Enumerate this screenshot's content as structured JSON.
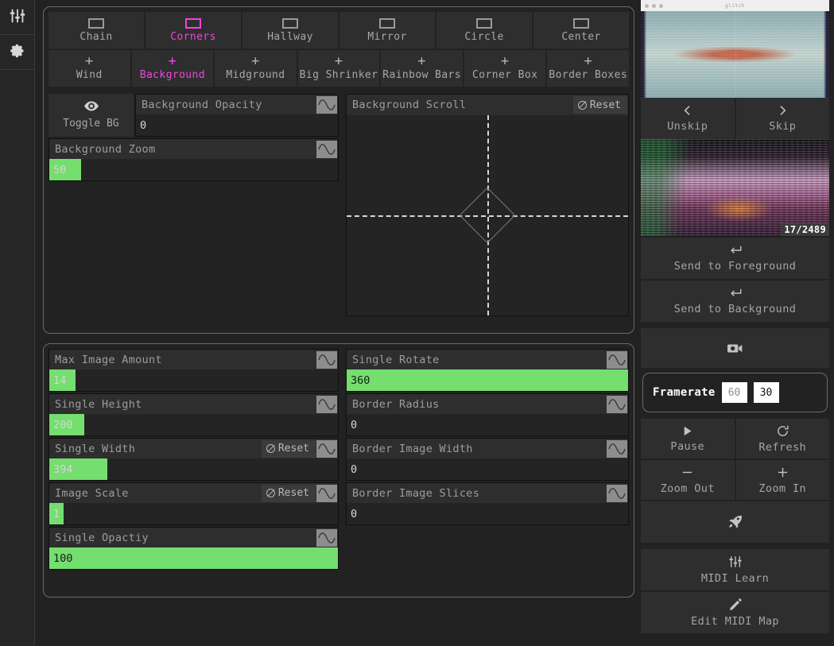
{
  "left_rail": {
    "items": [
      {
        "icon": "sliders-icon",
        "name": "mixer"
      },
      {
        "icon": "gear-icon",
        "name": "settings"
      }
    ]
  },
  "effects_panel": {
    "tabs_row1": [
      {
        "label": "Chain",
        "icon": "rect-icon",
        "active": false
      },
      {
        "label": "Corners",
        "icon": "rect-icon",
        "active": true
      },
      {
        "label": "Hallway",
        "icon": "rect-icon",
        "active": false
      },
      {
        "label": "Mirror",
        "icon": "rect-icon",
        "active": false
      },
      {
        "label": "Circle",
        "icon": "rect-icon",
        "active": false
      },
      {
        "label": "Center",
        "icon": "rect-icon",
        "active": false
      }
    ],
    "tabs_row2": [
      {
        "label": "Wind",
        "icon": "plus-icon",
        "active": false
      },
      {
        "label": "Background",
        "icon": "plus-icon",
        "active": true
      },
      {
        "label": "Midground",
        "icon": "plus-icon",
        "active": false
      },
      {
        "label": "Big Shrinker",
        "icon": "plus-icon",
        "active": false
      },
      {
        "label": "Rainbow Bars",
        "icon": "plus-icon",
        "active": false
      },
      {
        "label": "Corner Box",
        "icon": "plus-icon",
        "active": false
      },
      {
        "label": "Border Boxes",
        "icon": "plus-icon",
        "active": false
      }
    ],
    "toggle_bg": {
      "label": "Toggle BG",
      "icon": "eye-icon"
    },
    "sliders": [
      {
        "label": "Background Opacity",
        "value": "0",
        "fill_pct": 0,
        "has_reset": false,
        "wave": true
      },
      {
        "label": "Background Zoom",
        "value": "50",
        "fill_pct": 11,
        "has_reset": false,
        "wave": true
      }
    ],
    "xy_pad": {
      "label": "Background Scroll",
      "reset_label": "Reset"
    }
  },
  "params_panel": {
    "left_sliders": [
      {
        "label": "Max Image Amount",
        "value": "14",
        "fill_pct": 9,
        "has_reset": false,
        "wave": true
      },
      {
        "label": "Single Height",
        "value": "200",
        "fill_pct": 12,
        "has_reset": false,
        "wave": true
      },
      {
        "label": "Single Width",
        "value": "394",
        "fill_pct": 20,
        "has_reset": true,
        "wave": true
      },
      {
        "label": "Image Scale",
        "value": "1",
        "fill_pct": 5,
        "has_reset": true,
        "wave": true
      },
      {
        "label": "Single Opactiy",
        "value": "100",
        "fill_pct": 100,
        "has_reset": false,
        "wave": true
      }
    ],
    "right_sliders": [
      {
        "label": "Single Rotate",
        "value": "360",
        "fill_pct": 100,
        "has_reset": false,
        "wave": true
      },
      {
        "label": "Border Radius",
        "value": "0",
        "fill_pct": 0,
        "has_reset": false,
        "wave": true
      },
      {
        "label": "Border Image Width",
        "value": "0",
        "fill_pct": 0,
        "has_reset": false,
        "wave": true
      },
      {
        "label": "Border Image Slices",
        "value": "0",
        "fill_pct": 0,
        "has_reset": false,
        "wave": true
      }
    ],
    "reset_label": "Reset"
  },
  "sidebar": {
    "mini_window": {
      "title": "glitch"
    },
    "skip": [
      {
        "label": "Unskip",
        "icon": "chevron-left-icon"
      },
      {
        "label": "Skip",
        "icon": "chevron-right-icon"
      }
    ],
    "thumb": {
      "counter": "17/2489"
    },
    "send_buttons": [
      {
        "label": "Send to Foreground",
        "icon": "enter-arrow-icon"
      },
      {
        "label": "Send to Background",
        "icon": "enter-arrow-icon"
      }
    ],
    "webcam": {
      "label": "Toggle Webcam",
      "icon": "camera-icon"
    },
    "framerate": {
      "label": "Framerate",
      "options": [
        {
          "value": "60",
          "selected": false
        },
        {
          "value": "30",
          "selected": true
        }
      ]
    },
    "transport": [
      {
        "label": "Pause",
        "icon": "play-icon"
      },
      {
        "label": "Refresh",
        "icon": "refresh-icon"
      }
    ],
    "zoom": [
      {
        "label": "Zoom Out",
        "icon": "minus-icon"
      },
      {
        "label": "Zoom In",
        "icon": "plus-icon"
      }
    ],
    "autopilot": {
      "label": "Toggle Autopilot",
      "icon": "rocket-icon"
    },
    "midi": [
      {
        "label": "MIDI Learn",
        "icon": "sliders-icon"
      },
      {
        "label": "Edit MIDI Map",
        "icon": "pencil-icon"
      }
    ]
  },
  "colors": {
    "accent_magenta": "#f045e0",
    "slider_green": "#74de6e",
    "panel_bg": "#2e2e2e",
    "app_bg": "#222222"
  }
}
